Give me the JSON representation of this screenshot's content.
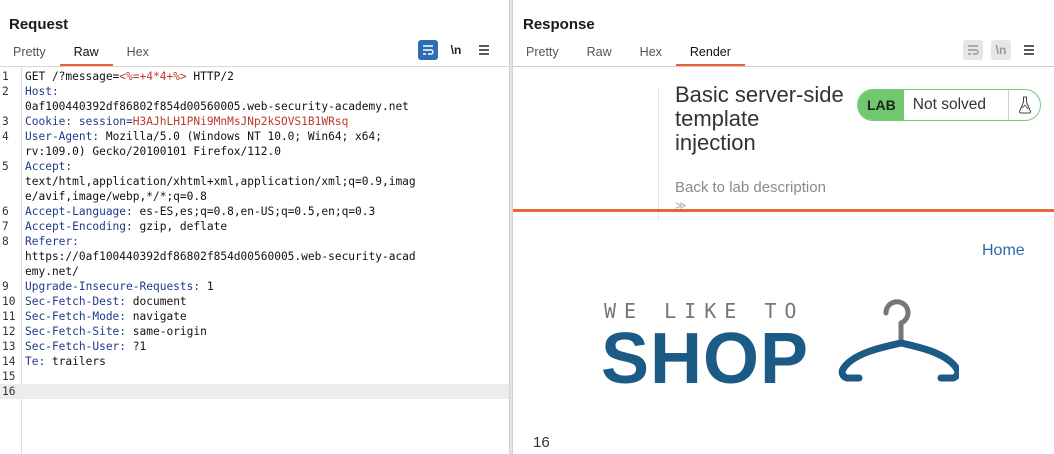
{
  "request": {
    "title": "Request",
    "tabs": [
      "Pretty",
      "Raw",
      "Hex"
    ],
    "active_tab": "Raw",
    "toolbar": {
      "wrap_icon": "wrap-lines-icon",
      "newline_label": "\\n",
      "menu_icon": "hamburger-menu-icon"
    },
    "lines": [
      {
        "n": "1",
        "parts": [
          {
            "t": "GET /?message="
          },
          {
            "t": "<%=+4*4+%>",
            "c": "red"
          },
          {
            "t": " HTTP/2"
          }
        ]
      },
      {
        "n": "2",
        "parts": [
          {
            "t": "Host:",
            "c": "hk"
          }
        ]
      },
      {
        "n": "",
        "parts": [
          {
            "t": "0af100440392df86802f854d00560005.web-security-academy.net"
          }
        ]
      },
      {
        "n": "3",
        "parts": [
          {
            "t": "Cookie: ",
            "c": "hk"
          },
          {
            "t": "session=",
            "c": "hk"
          },
          {
            "t": "H3AJhLH1PNi9MnMsJNp2kSOVS1B1WRsq",
            "c": "red"
          }
        ]
      },
      {
        "n": "4",
        "parts": [
          {
            "t": "User-Agent:",
            "c": "hk"
          },
          {
            "t": " Mozilla/5.0 (Windows NT 10.0; Win64; x64;"
          }
        ]
      },
      {
        "n": "",
        "parts": [
          {
            "t": "rv:109.0) Gecko/20100101 Firefox/112.0"
          }
        ]
      },
      {
        "n": "5",
        "parts": [
          {
            "t": "Accept:",
            "c": "hk"
          }
        ]
      },
      {
        "n": "",
        "parts": [
          {
            "t": "text/html,application/xhtml+xml,application/xml;q=0.9,imag"
          }
        ]
      },
      {
        "n": "",
        "parts": [
          {
            "t": "e/avif,image/webp,*/*;q=0.8"
          }
        ]
      },
      {
        "n": "6",
        "parts": [
          {
            "t": "Accept-Language:",
            "c": "hk"
          },
          {
            "t": " es-ES,es;q=0.8,en-US;q=0.5,en;q=0.3"
          }
        ]
      },
      {
        "n": "7",
        "parts": [
          {
            "t": "Accept-Encoding:",
            "c": "hk"
          },
          {
            "t": " gzip, deflate"
          }
        ]
      },
      {
        "n": "8",
        "parts": [
          {
            "t": "Referer:",
            "c": "hk"
          }
        ]
      },
      {
        "n": "",
        "parts": [
          {
            "t": "https://0af100440392df86802f854d00560005.web-security-acad"
          }
        ]
      },
      {
        "n": "",
        "parts": [
          {
            "t": "emy.net/"
          }
        ]
      },
      {
        "n": "9",
        "parts": [
          {
            "t": "Upgrade-Insecure-Requests:",
            "c": "hk"
          },
          {
            "t": " 1"
          }
        ]
      },
      {
        "n": "10",
        "parts": [
          {
            "t": "Sec-Fetch-Dest:",
            "c": "hk"
          },
          {
            "t": " document"
          }
        ]
      },
      {
        "n": "11",
        "parts": [
          {
            "t": "Sec-Fetch-Mode:",
            "c": "hk"
          },
          {
            "t": " navigate"
          }
        ]
      },
      {
        "n": "12",
        "parts": [
          {
            "t": "Sec-Fetch-Site:",
            "c": "hk"
          },
          {
            "t": " same-origin"
          }
        ]
      },
      {
        "n": "13",
        "parts": [
          {
            "t": "Sec-Fetch-User:",
            "c": "hk"
          },
          {
            "t": " ?1"
          }
        ]
      },
      {
        "n": "14",
        "parts": [
          {
            "t": "Te:",
            "c": "hk"
          },
          {
            "t": " trailers"
          }
        ]
      },
      {
        "n": "15",
        "parts": []
      },
      {
        "n": "16",
        "parts": [],
        "caret": true
      }
    ]
  },
  "response": {
    "title": "Response",
    "tabs": [
      "Pretty",
      "Raw",
      "Hex",
      "Render"
    ],
    "active_tab": "Render",
    "toolbar": {
      "wrap_icon": "wrap-lines-icon",
      "newline_label": "\\n",
      "menu_icon": "hamburger-menu-icon"
    },
    "render": {
      "lab_title": "Basic server-side template injection",
      "back_link": "Back to lab description",
      "back_arrows": "≫",
      "lab_badge": "LAB",
      "status": "Not solved",
      "home_link": "Home",
      "logo_top": "WE LIKE TO",
      "logo_main": "SHOP",
      "page_value": "16"
    }
  },
  "colors": {
    "accent": "#e8643c",
    "blue": "#2e6db4",
    "lab_green": "#70c96f",
    "shop_blue": "#1c5b86"
  }
}
